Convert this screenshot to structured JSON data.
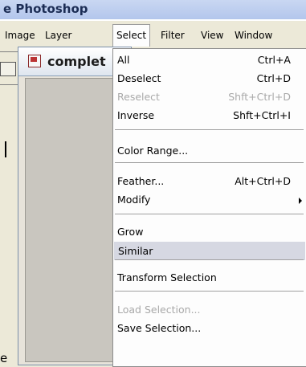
{
  "window": {
    "title": "e Photoshop"
  },
  "menubar": {
    "items": [
      "Image",
      "Layer",
      "Select",
      "Filter",
      "View",
      "Window"
    ],
    "active": "Select"
  },
  "document": {
    "title": "complet"
  },
  "select_menu": {
    "items": [
      {
        "label": "All",
        "shortcut": "Ctrl+A",
        "disabled": false
      },
      {
        "label": "Deselect",
        "shortcut": "Ctrl+D",
        "disabled": false
      },
      {
        "label": "Reselect",
        "shortcut": "Shft+Ctrl+D",
        "disabled": true
      },
      {
        "label": "Inverse",
        "shortcut": "Shft+Ctrl+I",
        "disabled": false
      },
      {
        "label": "Color Range...",
        "shortcut": "",
        "disabled": false
      },
      {
        "label": "Feather...",
        "shortcut": "Alt+Ctrl+D",
        "disabled": false
      },
      {
        "label": "Modify",
        "shortcut": "",
        "disabled": false,
        "submenu": true
      },
      {
        "label": "Grow",
        "shortcut": "",
        "disabled": false
      },
      {
        "label": "Similar",
        "shortcut": "",
        "disabled": false,
        "highlighted": true
      },
      {
        "label": "Transform Selection",
        "shortcut": "",
        "disabled": false
      },
      {
        "label": "Load Selection...",
        "shortcut": "",
        "disabled": true
      },
      {
        "label": "Save Selection...",
        "shortcut": "",
        "disabled": false
      }
    ]
  },
  "footer_text": "e"
}
